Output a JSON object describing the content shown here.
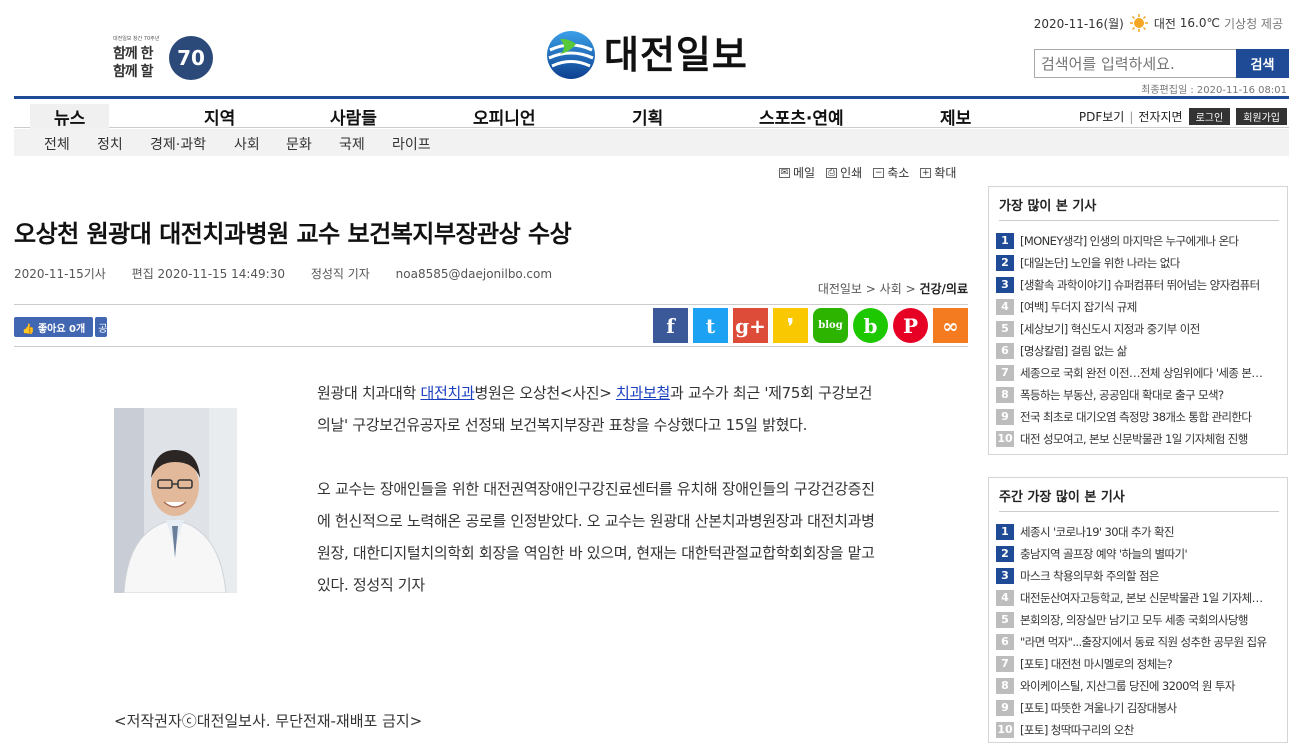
{
  "header": {
    "anniversary": {
      "small": "대전일보 창간 70주년",
      "line1": "함께 한",
      "line2": "함께 할",
      "number": "70"
    },
    "logo_text": "대전일보",
    "date": "2020-11-16(월)",
    "weather_city": "대전",
    "temperature": "16.0℃",
    "weather_provider": "기상청 제공",
    "search_placeholder": "검색어를 입력하세요.",
    "search_button": "검색",
    "last_edit": "최종편집일 : 2020-11-16 08:01"
  },
  "nav": {
    "main": [
      "뉴스",
      "지역",
      "사람들",
      "오피니언",
      "기획",
      "스포츠·연예",
      "제보"
    ],
    "pdf": "PDF보기",
    "epaper": "전자지면",
    "login": "로그인",
    "join": "회원가입",
    "sub": [
      "전체",
      "정치",
      "경제·과학",
      "사회",
      "문화",
      "국제",
      "라이프"
    ]
  },
  "tools": {
    "email": "메일",
    "print": "인쇄",
    "shrink": "축소",
    "enlarge": "확대"
  },
  "article": {
    "headline": "오상천 원광대 대전치과병원 교수 보건복지부장관상 수상",
    "published": "2020-11-15기사",
    "edited": "편집 2020-11-15 14:49:30",
    "reporter": "정성직 기자",
    "email": "noa8585@daejonilbo.com",
    "breadcrumb": {
      "a": "대전일보",
      "b": "사회",
      "c": "건강/의료"
    },
    "like_label": "좋아요 0개",
    "share_label": "공",
    "p1_pre": "원광대 치과대학 ",
    "p1_link1": "대전치과",
    "p1_mid": "병원은 오상천<사진> ",
    "p1_link2": "치과보철",
    "p1_post": "과 교수가 최근 '제75회 구강보건의날' 구강보건유공자로 선정돼 보건복지부장관 표창을 수상했다고 15일 밝혔다.",
    "p2": "오 교수는 장애인들을 위한 대전권역장애인구강진료센터를 유치해 장애인들의 구강건강증진에 헌신적으로 노력해온 공로를 인정받았다. 오 교수는 원광대 산본치과병원장과 대전치과병원장, 대한디지털치의학회 회장을 역임한 바 있으며, 현재는 대한턱관절교합학회회장을 맡고 있다. 정성직 기자",
    "copyright": "<저작권자ⓒ대전일보사. 무단전재-재배포 금지>"
  },
  "share_icons": [
    {
      "name": "facebook-icon",
      "glyph": "f",
      "color": "#3b5998"
    },
    {
      "name": "twitter-icon",
      "glyph": "t",
      "color": "#1da1f2"
    },
    {
      "name": "googleplus-icon",
      "glyph": "g+",
      "color": "#dd4b39"
    },
    {
      "name": "kakaostory-icon",
      "glyph": "❜",
      "color": "#f9c800"
    },
    {
      "name": "blog-icon",
      "glyph": "blog",
      "color": "#2db400"
    },
    {
      "name": "band-icon",
      "glyph": "b",
      "color": "#1ec800"
    },
    {
      "name": "pinterest-icon",
      "glyph": "P",
      "color": "#e60023"
    },
    {
      "name": "link-icon",
      "glyph": "∞",
      "color": "#f47b20"
    }
  ],
  "most_viewed": {
    "title": "가장 많이 본 기사",
    "items": [
      "[MONEY생각] 인생의 마지막은 누구에게나 온다",
      "[대일논단] 노인을 위한 나라는 없다",
      "[생활속 과학이야기] 슈퍼컴퓨터 뛰어넘는 양자컴퓨터",
      "[여백] 두더지 잡기식 규제",
      "[세상보기] 혁신도시 지정과 중기부 이전",
      "[명상칼럼] 걸림 없는 삶",
      "세종으로 국회 완전 이전…전체 상임위에다 '세종 본…",
      "폭등하는 부동산, 공공임대 확대로 출구 모색?",
      "전국 최초로 대기오염 측정망 38개소 통합 관리한다",
      "대전 성모여고, 본보 신문박물관 1일 기자체험 진행"
    ]
  },
  "weekly_most_viewed": {
    "title": "주간 가장 많이 본 기사",
    "items": [
      "세종시 '코로나19' 30대 추가 확진",
      "충남지역 골프장 예약 '하늘의 별따기'",
      "마스크 착용의무화 주의할 점은",
      "대전둔산여자고등학교, 본보 신문박물관 1일 기자체…",
      "본회의장, 의장실만 남기고 모두 세종 국회의사당행",
      "\"라면 먹자\"...출장지에서 동료 직원 성추한 공무원 집유",
      "[포토] 대전천 마시멜로의 정체는?",
      "와이케이스틸, 지산그룹 당진에 3200억 원 투자",
      "[포토] 따뜻한 겨울나기 김장대봉사",
      "[포토] 청딱따구리의 오찬"
    ]
  }
}
